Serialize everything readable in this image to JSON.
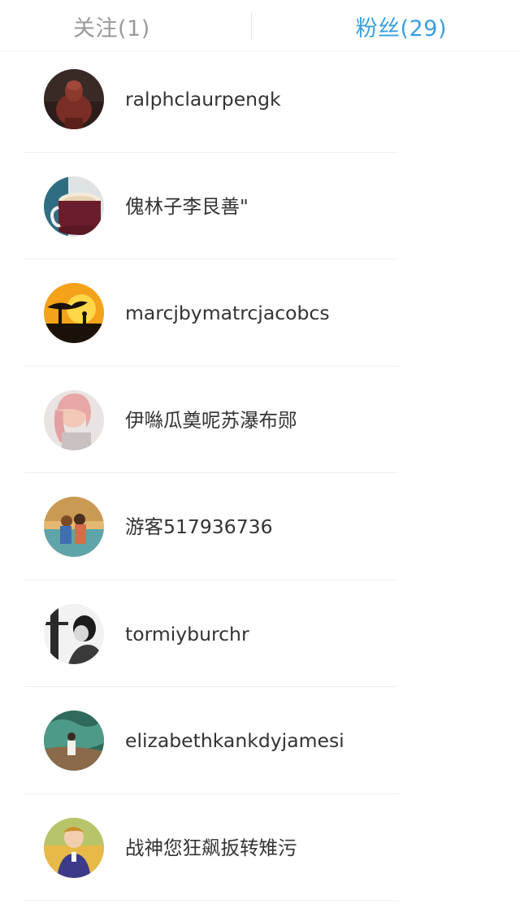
{
  "tabs": {
    "following": "关注(1)",
    "fans": "粉丝(29)",
    "active": "fans",
    "active_color": "#3a9fe0",
    "inactive_color": "#9a9a9a"
  },
  "fans": [
    {
      "name": "ralphclaurpengk",
      "avatar": "statue-avatar"
    },
    {
      "name": "傀林子李艮善\"",
      "avatar": "mug-avatar"
    },
    {
      "name": "marcjbymatrcjacobcs",
      "avatar": "sunset-tree-avatar"
    },
    {
      "name": "伊噝瓜奠呢苏瀑布郧",
      "avatar": "girl-avatar"
    },
    {
      "name": "游客517936736",
      "avatar": "couple-avatar"
    },
    {
      "name": "tormiyburchr",
      "avatar": "bw-portrait-avatar"
    },
    {
      "name": "elizabethkankdyjamesi",
      "avatar": "wave-avatar"
    },
    {
      "name": "战神您狂飙扳转雉污",
      "avatar": "child-avatar"
    }
  ]
}
